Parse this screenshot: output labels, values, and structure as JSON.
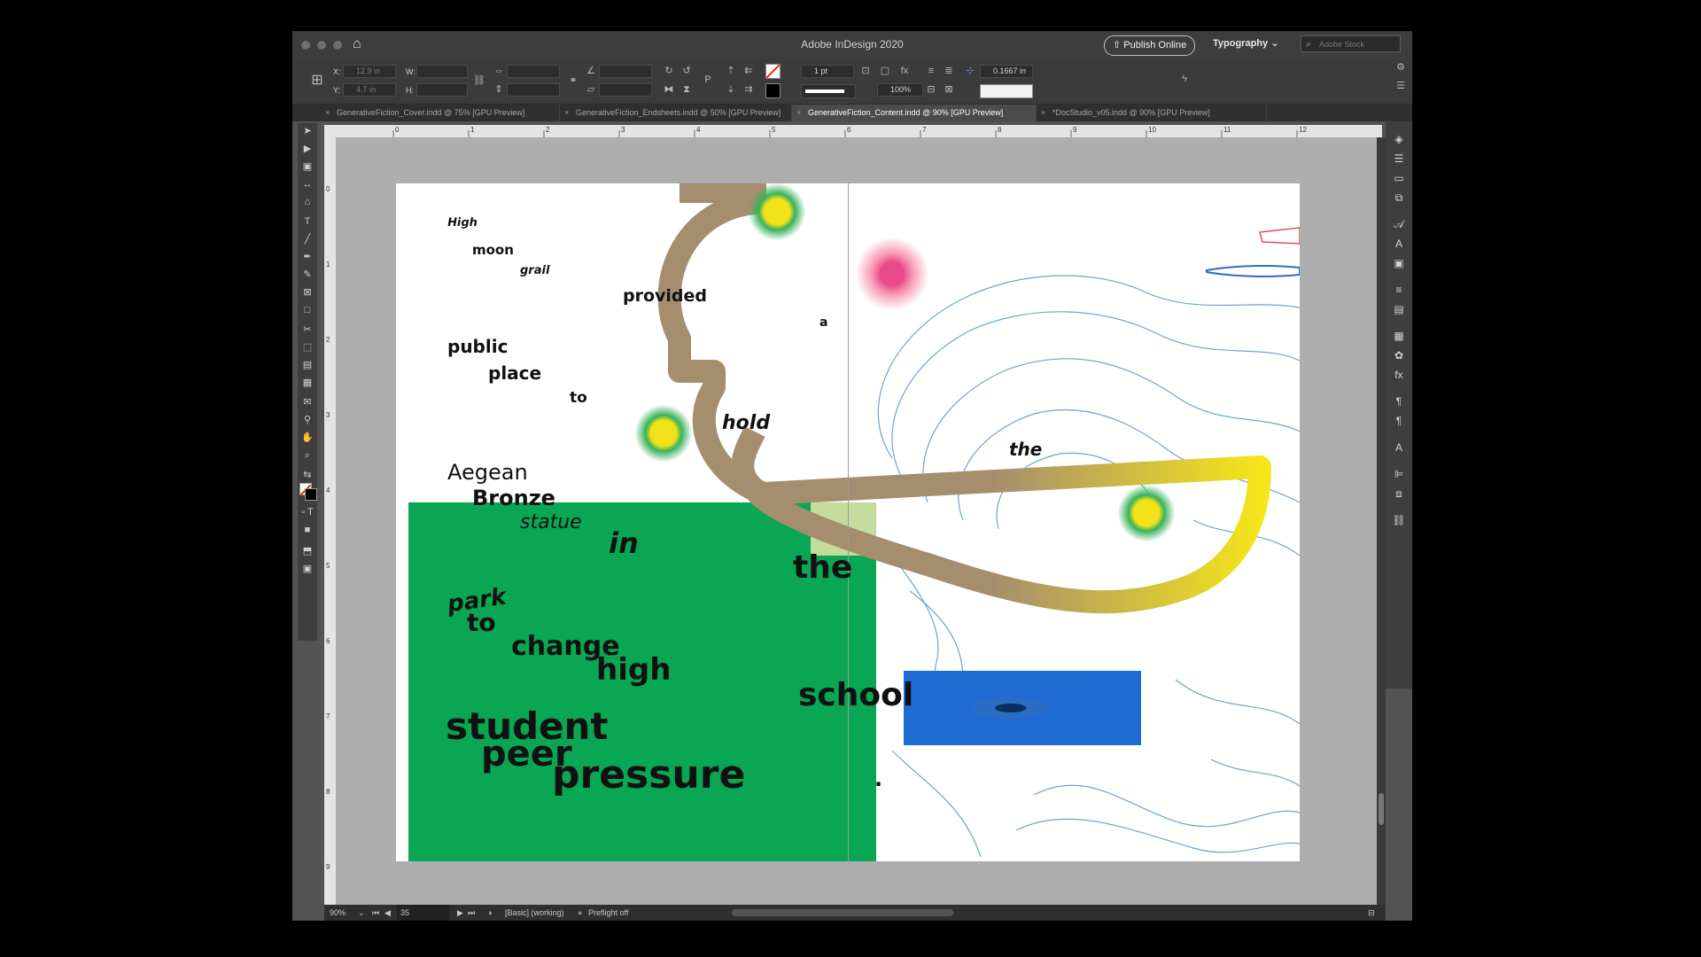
{
  "app": {
    "title": "Adobe InDesign 2020",
    "publish_label": "Publish Online",
    "workspace": "Typography",
    "workspace_chevron": "⌄",
    "stock_placeholder": "Adobe Stock"
  },
  "control": {
    "x_label": "X:",
    "x_value": "12.9 in",
    "y_label": "Y:",
    "y_value": "4.7 in",
    "w_label": "W:",
    "w_value": "",
    "h_label": "H:",
    "h_value": "",
    "stroke_weight": "1 pt",
    "scale_value": "100%",
    "spacing_value": "0.1667 in"
  },
  "tabs": [
    {
      "label": "GenerativeFiction_Cover.indd @ 75% [GPU Preview]"
    },
    {
      "label": "GenerativeFiction_Endsheets.indd @ 50% [GPU Preview]"
    },
    {
      "label": "GenerativeFiction_Content.indd @ 90% [GPU Preview]"
    },
    {
      "label": "*DocStudio_v05.indd @ 90% [GPU Preview]"
    }
  ],
  "ruler": {
    "h_ticks": [
      "0",
      "1",
      "2",
      "3",
      "4",
      "5",
      "6",
      "7",
      "8",
      "9",
      "10",
      "11",
      "12"
    ],
    "v_ticks": [
      "0",
      "1",
      "2",
      "3",
      "4",
      "5",
      "6",
      "7",
      "8",
      "9"
    ]
  },
  "status": {
    "zoom": "90%",
    "page": "35",
    "style": "[Basic] (working)",
    "preflight": "Preflight off"
  },
  "artwork": {
    "words": [
      "High",
      "moon",
      "grail",
      "provided",
      "a",
      "public",
      "place",
      "to",
      "hold",
      "the",
      "Aegean",
      "Bronze",
      "statue",
      "in",
      "the",
      "park",
      "to",
      "change",
      "high",
      "school",
      "student",
      "peer",
      "pressure",
      "."
    ],
    "colors": {
      "green": "#09a653",
      "tan": "#a58e6e",
      "yellow": "#f6e51a",
      "blue": "#1e6fd0",
      "contour": "#6ba4d9",
      "pink": "#f0407d"
    }
  }
}
